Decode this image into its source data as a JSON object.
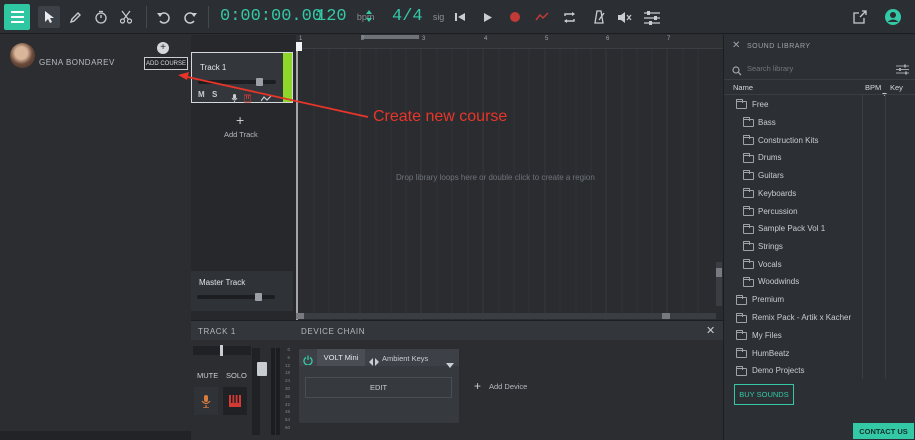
{
  "toolbar": {
    "time": "0:00:00.00",
    "bpm_value": "120",
    "bpm_unit": "bpm",
    "time_sig": "4/4",
    "sig_unit": "sig",
    "icons": [
      "menu-icon",
      "pointer-icon",
      "pencil-icon",
      "stopwatch-icon",
      "scissors-icon",
      "undo-icon",
      "redo-icon",
      "skip-back-icon",
      "play-icon",
      "record-icon",
      "automation-icon",
      "loop-icon",
      "metronome-icon",
      "tuner-icon",
      "mixer-icon",
      "share-icon",
      "account-icon"
    ],
    "accent": "#34c9a6"
  },
  "profile": {
    "name": "GENA BONDAREV",
    "add_course_label": "ADD COURSE"
  },
  "annotation": {
    "text": "Create new course",
    "color": "#e8352a"
  },
  "tracks": {
    "track1_name": "Track 1",
    "buttons": [
      "M",
      "S"
    ],
    "add_track_label": "Add Track",
    "master_name": "Master Track",
    "track_color": "#8ed62a"
  },
  "timeline": {
    "ruler_marks": [
      "1",
      "2",
      "3",
      "4",
      "5",
      "6",
      "7"
    ],
    "empty_hint": "Drop library loops here or double click to create a region"
  },
  "device_chain": {
    "track_label": "TRACK 1",
    "title": "DEVICE CHAIN",
    "mute_label": "MUTE",
    "solo_label": "SOLO",
    "device_name": "VOLT Mini",
    "preset_name": "Ambient Keys",
    "edit_label": "EDIT",
    "add_device_label": "Add Device",
    "meter_scale": [
      "0",
      "6",
      "12",
      "18",
      "24",
      "30",
      "36",
      "42",
      "48",
      "54",
      "60"
    ]
  },
  "library": {
    "title": "SOUND LIBRARY",
    "search_placeholder": "Search library",
    "col_name": "Name",
    "col_bpm": "BPM",
    "col_key": "Key",
    "items": [
      {
        "label": "Free",
        "level": 0
      },
      {
        "label": "Bass",
        "level": 1
      },
      {
        "label": "Construction Kits",
        "level": 1
      },
      {
        "label": "Drums",
        "level": 1
      },
      {
        "label": "Guitars",
        "level": 1
      },
      {
        "label": "Keyboards",
        "level": 1
      },
      {
        "label": "Percussion",
        "level": 1
      },
      {
        "label": "Sample Pack Vol 1",
        "level": 1
      },
      {
        "label": "Strings",
        "level": 1
      },
      {
        "label": "Vocals",
        "level": 1
      },
      {
        "label": "Woodwinds",
        "level": 1
      },
      {
        "label": "Premium",
        "level": 0
      },
      {
        "label": "Remix Pack - Artik x Kacher",
        "level": 0
      },
      {
        "label": "My Files",
        "level": 0
      },
      {
        "label": "HumBeatz",
        "level": 0
      },
      {
        "label": "Demo Projects",
        "level": 0
      }
    ],
    "buy_label": "BUY SOUNDS",
    "contact_label": "CONTACT US"
  }
}
